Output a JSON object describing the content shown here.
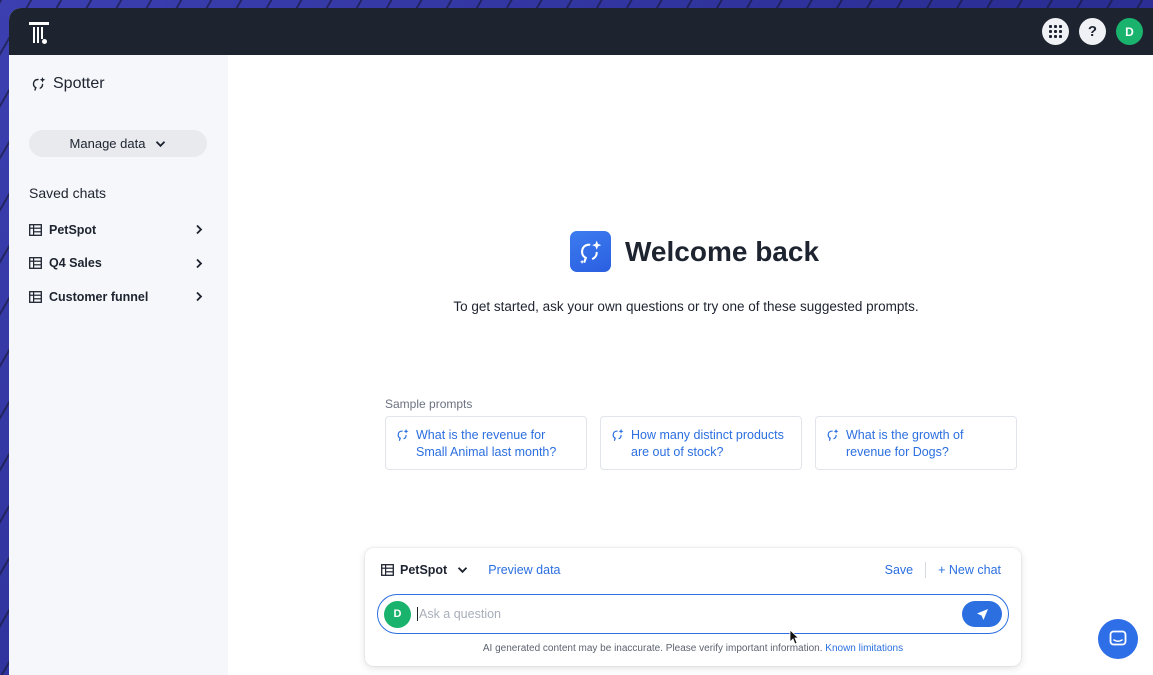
{
  "topbar": {
    "avatar_initial": "D",
    "help_label": "?"
  },
  "sidebar": {
    "title": "Spotter",
    "manage_data_label": "Manage data",
    "saved_chats_heading": "Saved chats",
    "items": [
      {
        "label": "PetSpot"
      },
      {
        "label": "Q4 Sales"
      },
      {
        "label": "Customer funnel"
      }
    ]
  },
  "main": {
    "welcome_title": "Welcome back",
    "subtitle": "To get started, ask your own questions or try one of these suggested prompts.",
    "sample_label": "Sample prompts",
    "prompts": [
      {
        "line1": "What is the revenue for",
        "line2": "Small Animal last month?"
      },
      {
        "line1": "How many distinct products",
        "line2": "are out of stock?"
      },
      {
        "line1": "What is the growth of",
        "line2": "revenue for Dogs?"
      }
    ]
  },
  "chatbox": {
    "source_label": "PetSpot",
    "preview_label": "Preview data",
    "save_label": "Save",
    "new_chat_label": "+ New chat",
    "avatar_initial": "D",
    "input_placeholder": "Ask a question",
    "disclaimer": "AI generated content may be inaccurate. Please verify important information.",
    "disclaimer_link": "Known limitations"
  },
  "colors": {
    "accent": "#2b6fe0",
    "topbar": "#1d232f",
    "avatar": "#19b36d"
  }
}
